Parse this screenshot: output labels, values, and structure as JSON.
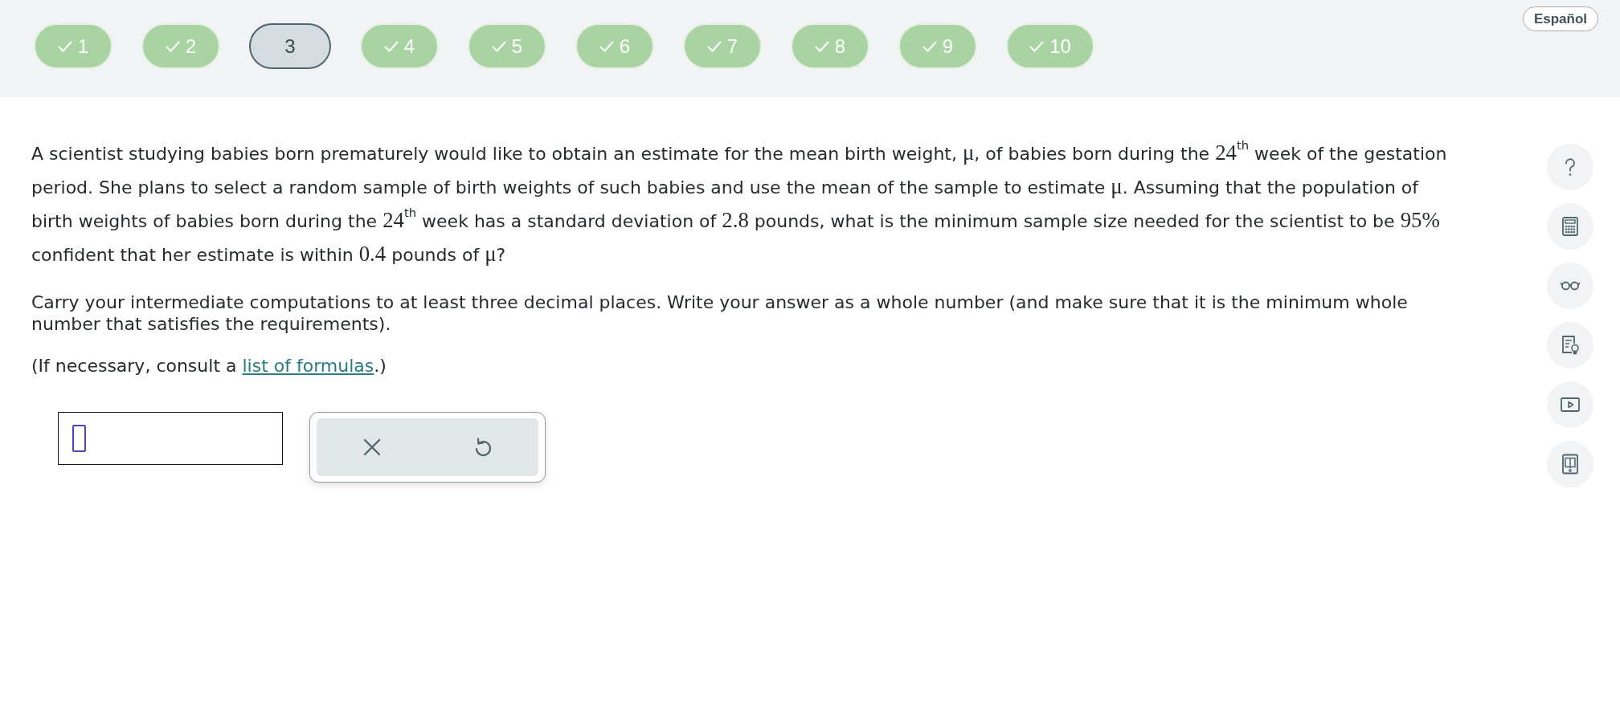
{
  "language_button": {
    "label": "Español"
  },
  "questions": [
    {
      "label": "1",
      "answered": true,
      "selected": false
    },
    {
      "label": "2",
      "answered": true,
      "selected": false
    },
    {
      "label": "3",
      "answered": false,
      "selected": true
    },
    {
      "label": "4",
      "answered": true,
      "selected": false
    },
    {
      "label": "5",
      "answered": true,
      "selected": false
    },
    {
      "label": "6",
      "answered": true,
      "selected": false
    },
    {
      "label": "7",
      "answered": true,
      "selected": false
    },
    {
      "label": "8",
      "answered": true,
      "selected": false
    },
    {
      "label": "9",
      "answered": true,
      "selected": false
    },
    {
      "label": "10",
      "answered": true,
      "selected": false
    }
  ],
  "problem": {
    "parts": [
      {
        "kind": "text",
        "text": "A scientist studying babies born prematurely would like to obtain an estimate for the mean birth weight, "
      },
      {
        "kind": "math",
        "text": "μ"
      },
      {
        "kind": "text",
        "text": ", of babies born during the "
      },
      {
        "kind": "math",
        "text": "24$^{th}$"
      },
      {
        "kind": "text",
        "text": " week of the gestation period. She plans to select a random sample of birth weights of such babies and use the mean of the sample to estimate "
      },
      {
        "kind": "math",
        "text": "μ"
      },
      {
        "kind": "text",
        "text": ". Assuming that the population of birth weights of babies born during the "
      },
      {
        "kind": "math",
        "text": "24$^{th}$"
      },
      {
        "kind": "text",
        "text": " week has a standard deviation of "
      },
      {
        "kind": "math",
        "text": "2.8"
      },
      {
        "kind": "text",
        "text": " pounds, what is the minimum sample size needed for the scientist to be "
      },
      {
        "kind": "math",
        "text": "95%"
      },
      {
        "kind": "text",
        "text": " confident that her estimate is within "
      },
      {
        "kind": "math",
        "text": "0.4"
      },
      {
        "kind": "text",
        "text": " pounds of "
      },
      {
        "kind": "math",
        "text": "μ"
      },
      {
        "kind": "text",
        "text": "?"
      }
    ]
  },
  "instructions": "Carry your intermediate computations to at least three decimal places. Write your answer as a whole number (and make sure that it is the minimum whole number that satisfies the requirements).",
  "formula_note": {
    "before": "(If necessary, consult a ",
    "link": "list of formulas",
    "after": ".)"
  },
  "answer": {
    "focused": true
  }
}
